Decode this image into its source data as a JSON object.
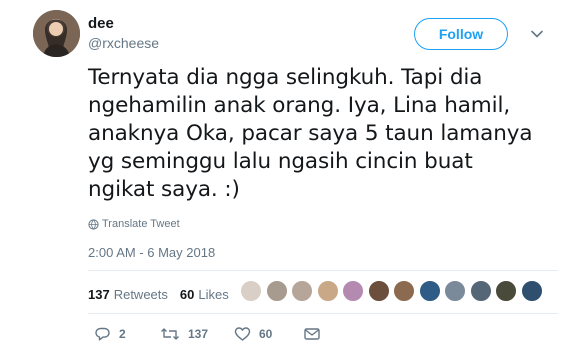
{
  "user": {
    "display_name": "dee",
    "handle": "@rxcheese",
    "follow_label": "Follow"
  },
  "tweet": {
    "text": "Ternyata dia ngga selingkuh. Tapi dia\nngehamilin anak orang. Iya, Lina hamil,\nanaknya Oka, pacar saya 5 taun lamanya\nyg seminggu lalu ngasih cincin buat\nngikat saya. :)",
    "translate_label": "Translate Tweet",
    "timestamp": "2:00 AM - 6 May 2018"
  },
  "stats": {
    "retweets_count": "137",
    "retweets_label": "Retweets",
    "likes_count": "60",
    "likes_label": "Likes"
  },
  "likers": {
    "colors": [
      "#d9cfc6",
      "#a79a8e",
      "#b6a69a",
      "#c8a887",
      "#b58ab0",
      "#6b4f3c",
      "#8b6a4f",
      "#2e5c86",
      "#7a8a9a",
      "#556677",
      "#4a4a3a",
      "#2f4f6f"
    ]
  },
  "actions": {
    "reply_count": "2",
    "retweet_count": "137",
    "like_count": "60"
  },
  "colors": {
    "accent": "#1da1f2",
    "muted": "#657786",
    "text": "#14171a",
    "divider": "#e6ecf0"
  }
}
